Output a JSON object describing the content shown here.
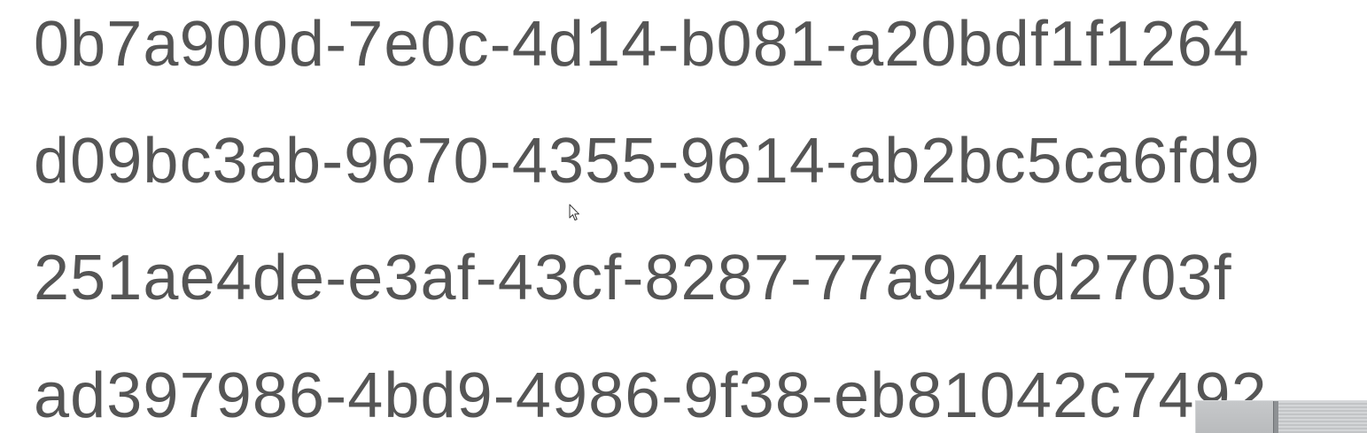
{
  "lines": [
    "0b7a900d-7e0c-4d14-b081-a20bdf1f1264",
    "d09bc3ab-9670-4355-9614-ab2bc5ca6fd9",
    "251ae4de-e3af-43cf-8287-77a944d2703f",
    "ad397986-4bd9-4986-9f38-eb81042c7492"
  ],
  "colors": {
    "text": "#555555",
    "background": "#ffffff"
  },
  "icons": {
    "cursor": "mouse-pointer-icon"
  }
}
